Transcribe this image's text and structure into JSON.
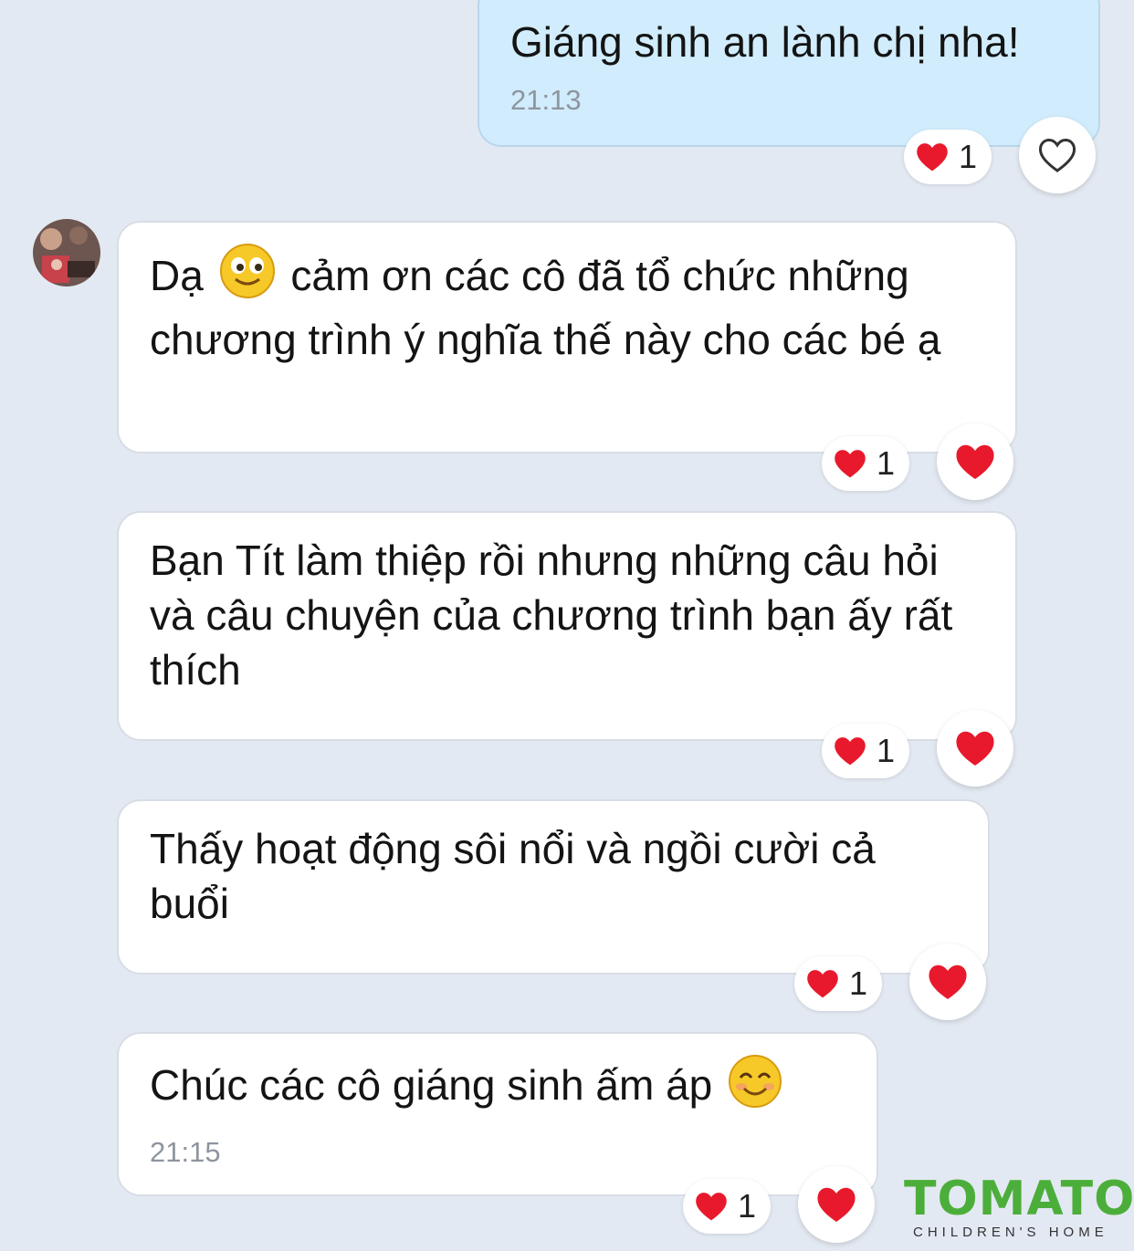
{
  "messages": [
    {
      "direction": "out",
      "text": "Giáng sinh an lành chị nha!",
      "time": "21:13",
      "reaction_count": "1",
      "reacted": false
    },
    {
      "direction": "in",
      "text_before_emoji": "Dạ ",
      "text_after_emoji": " cảm ơn các cô đã tổ chức những chương trình ý nghĩa thế này cho các bé ạ",
      "reaction_count": "1",
      "reacted": true
    },
    {
      "direction": "in",
      "text": "Bạn Tít làm thiệp rồi nhưng những câu hỏi và câu chuyện của chương trình bạn ấy rất thích",
      "reaction_count": "1",
      "reacted": true
    },
    {
      "direction": "in",
      "text": "Thấy hoạt động sôi nổi và ngồi cười cả buổi",
      "reaction_count": "1",
      "reacted": true
    },
    {
      "direction": "in",
      "text": "Chúc các cô giáng sinh ấm áp ",
      "time": "21:15",
      "reaction_count": "1",
      "reacted": true
    }
  ],
  "icons": {
    "heart_color": "#e8192c",
    "smile_emoji": "smiling-face-emoji",
    "blush_emoji": "smiling-eyes-emoji"
  },
  "logo": {
    "title": "TOMATO",
    "subtitle": "CHILDREN'S HOME"
  }
}
